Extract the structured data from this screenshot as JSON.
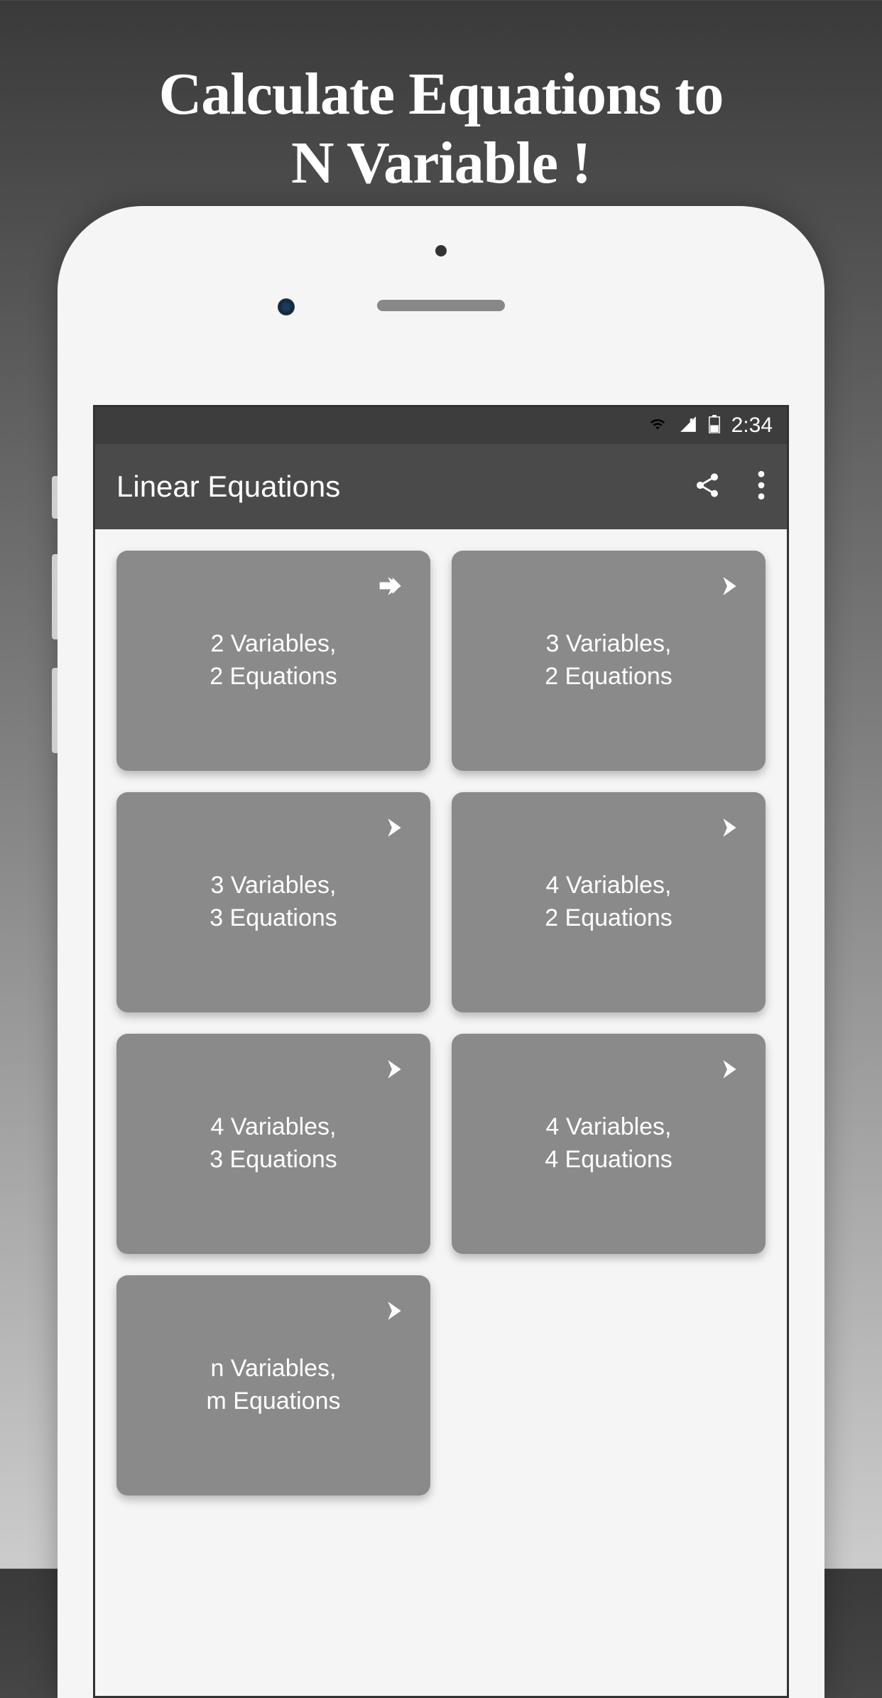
{
  "promo": {
    "title_line1": "Calculate Equations to",
    "title_line2": "N Variable !"
  },
  "status_bar": {
    "time": "2:34"
  },
  "app_bar": {
    "title": "Linear Equations"
  },
  "cards": [
    {
      "line1": "2 Variables,",
      "line2": "2 Equations"
    },
    {
      "line1": "3 Variables,",
      "line2": "2 Equations"
    },
    {
      "line1": "3 Variables,",
      "line2": "3 Equations"
    },
    {
      "line1": "4 Variables,",
      "line2": "2 Equations"
    },
    {
      "line1": "4 Variables,",
      "line2": "3 Equations"
    },
    {
      "line1": "4 Variables,",
      "line2": "4 Equations"
    },
    {
      "line1": "n Variables,",
      "line2": "m Equations"
    }
  ]
}
